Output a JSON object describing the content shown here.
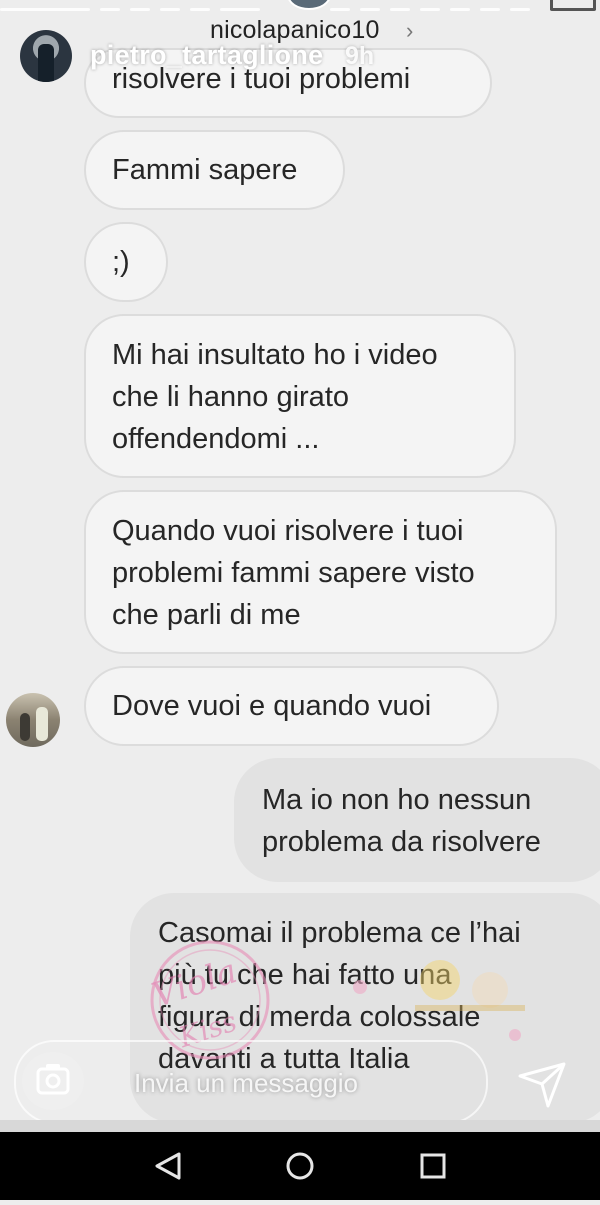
{
  "header": {
    "username": "nicolapanico10",
    "chevron": "›"
  },
  "story": {
    "username": "pietro_tartaglione",
    "time": "9h"
  },
  "messages": [
    {
      "direction": "in",
      "lines": [
        "risolvere i tuoi problemi"
      ]
    },
    {
      "direction": "in",
      "lines": [
        "Fammi sapere"
      ]
    },
    {
      "direction": "in",
      "lines": [
        ";)"
      ]
    },
    {
      "direction": "in",
      "lines": [
        "Mi hai insultato ho i video",
        "che li hanno girato",
        "offendendomi ..."
      ]
    },
    {
      "direction": "in",
      "lines": [
        "Quando vuoi risolvere i tuoi",
        "problemi fammi sapere visto",
        "che parli di me"
      ]
    },
    {
      "direction": "in",
      "lines": [
        "Dove vuoi e quando vuoi"
      ]
    },
    {
      "direction": "out",
      "lines": [
        "Ma io non ho nessun",
        "problema da risolvere"
      ]
    },
    {
      "direction": "out",
      "lines": [
        "Casomai il problema ce l’hai",
        "più tu che hai fatto una",
        "figura di merda colossale",
        "davanti a tutta Italia"
      ]
    }
  ],
  "watermark": {
    "text": "Viola Kiss"
  },
  "composer": {
    "placeholder": "Invia un messaggio",
    "camera_icon": "camera-icon",
    "send_icon": "send-icon"
  },
  "navigation": {
    "back_icon": "back-triangle-icon",
    "home_icon": "home-circle-icon",
    "recents_icon": "recents-square-icon"
  },
  "colors": {
    "background": "#ededed",
    "bubble_in": "#f4f4f4",
    "bubble_out": "#e2e2e2",
    "nav_bar": "#000000"
  }
}
